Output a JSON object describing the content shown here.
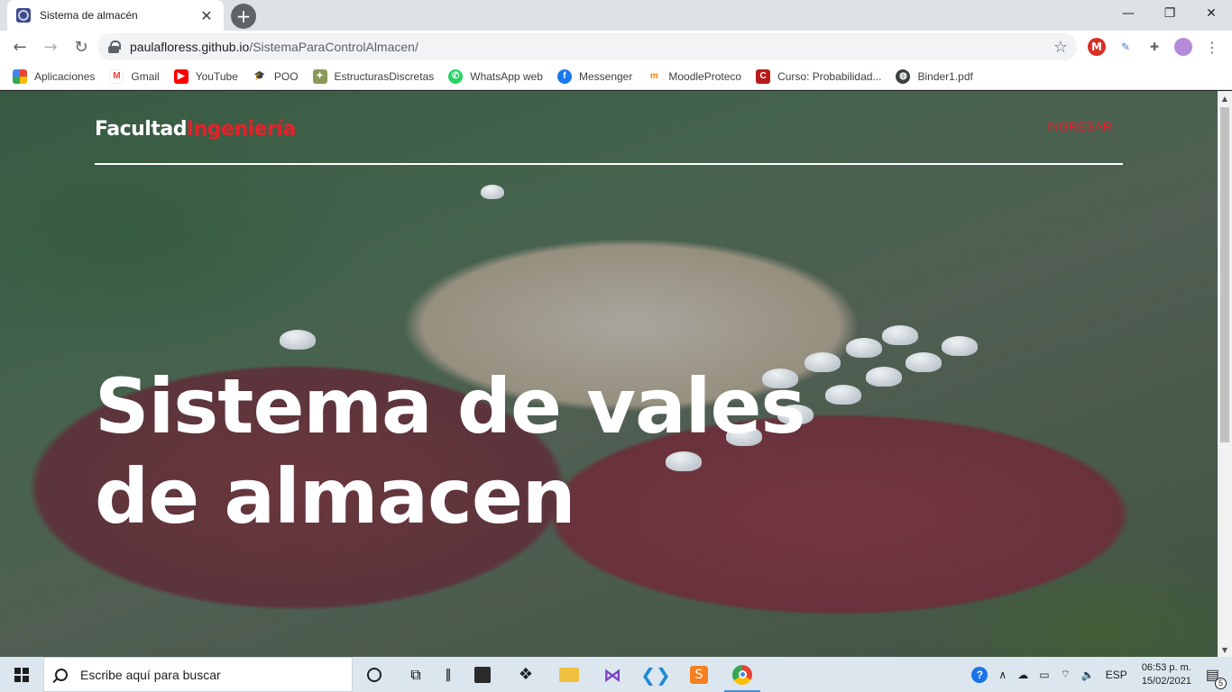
{
  "browser": {
    "tab_title": "Sistema de almacén",
    "url_host": "paulafloress.github.io",
    "url_path": "/SistemaParaControlAlmacen/",
    "bookmarks": [
      {
        "label": "Aplicaciones",
        "icon": "apps-grid-icon",
        "color": "#ea4335"
      },
      {
        "label": "Gmail",
        "icon": "gmail-icon",
        "color": "#ea4335"
      },
      {
        "label": "YouTube",
        "icon": "youtube-icon",
        "color": "#ff0000"
      },
      {
        "label": "POO",
        "icon": "graduation-cap-icon",
        "color": "#202124"
      },
      {
        "label": "EstructurasDiscretas",
        "icon": "course-icon",
        "color": "#6a7b4a"
      },
      {
        "label": "WhatsApp web",
        "icon": "whatsapp-icon",
        "color": "#25d366"
      },
      {
        "label": "Messenger",
        "icon": "facebook-icon",
        "color": "#1877f2"
      },
      {
        "label": "MoodleProteco",
        "icon": "moodle-icon",
        "color": "#f98012"
      },
      {
        "label": "Curso: Probabilidad...",
        "icon": "course-red-icon",
        "color": "#b71c1c"
      },
      {
        "label": "Binder1.pdf",
        "icon": "globe-icon",
        "color": "#3c4043"
      }
    ]
  },
  "site": {
    "logo_main": "Facultad",
    "logo_accent": "Ingeniería",
    "login_label": "INGRESAR",
    "hero_line1": "Sistema de vales",
    "hero_line2": "de almacen",
    "accent_color": "#e8202a"
  },
  "taskbar": {
    "search_placeholder": "Escribe aquí para buscar",
    "language": "ESP",
    "time": "06:53 p. m.",
    "date": "15/02/2021",
    "notification_count": "5"
  }
}
